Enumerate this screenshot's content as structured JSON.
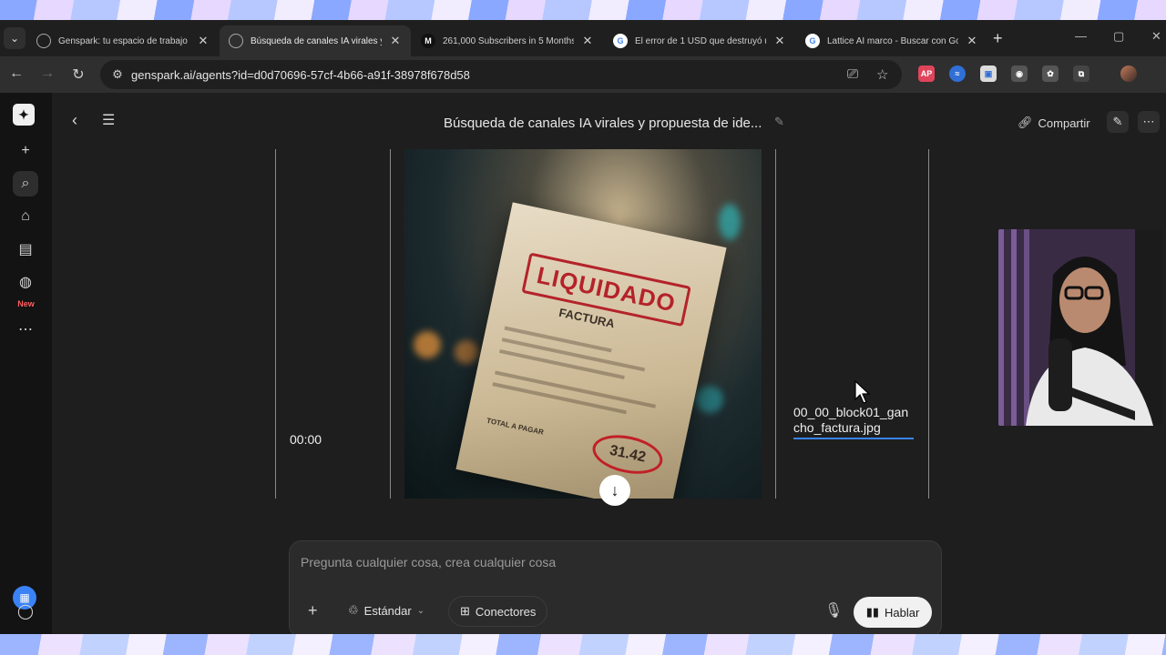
{
  "tabs": [
    {
      "title": "Genspark: tu espacio de trabajo d",
      "fav": "G",
      "fav_color": "#2a2a2a",
      "fav_text": "#ddd"
    },
    {
      "title": "Búsqueda de canales IA virales y p",
      "fav": "G",
      "fav_color": "#2a2a2a",
      "fav_text": "#ddd"
    },
    {
      "title": "261,000 Subscribers in 5 Months w",
      "fav": "M",
      "fav_color": "#111111",
      "fav_text": "#fff"
    },
    {
      "title": "El error de 1 USD que destruyó un",
      "fav": "G",
      "fav_color": "#ffffff",
      "fav_text": "#4285f4"
    },
    {
      "title": "Lattice AI marco - Buscar con Goo",
      "fav": "G",
      "fav_color": "#ffffff",
      "fav_text": "#4285f4"
    }
  ],
  "address_bar": {
    "url": "genspark.ai/agents?id=d0d70696-57cf-4b66-a91f-38978f678d58"
  },
  "extensions": [
    {
      "label": "AP",
      "color": "#e0445b"
    },
    {
      "label": "≈",
      "color": "#2f6fd6"
    },
    {
      "label": "▣",
      "color": "#dcdcdc"
    },
    {
      "label": "◉",
      "color": "#777777"
    },
    {
      "label": "✿",
      "color": "#888888"
    },
    {
      "label": "⧉",
      "color": "#777777"
    }
  ],
  "sidebar": {
    "new_badge": "New"
  },
  "header": {
    "title": "Búsqueda de canales IA virales y propuesta de ide...",
    "share_label": "Compartir"
  },
  "timeline": {
    "timecode": "00:00",
    "filename": "00_00_block01_gancho_factura.jpg",
    "image": {
      "stamp": "LIQUIDADO",
      "doc_label": "FACTURA",
      "total_label": "TOTAL A PAGAR",
      "amount": "31.42"
    }
  },
  "composer": {
    "placeholder": "Pregunta cualquier cosa, crea cualquier cosa",
    "mode_label": "Estándar",
    "connectors_label": "Conectores",
    "talk_label": "Hablar"
  },
  "colors": {
    "accent_blue": "#3b82f6",
    "stamp_red": "#b4232a",
    "new_badge": "#ff5f5f"
  }
}
